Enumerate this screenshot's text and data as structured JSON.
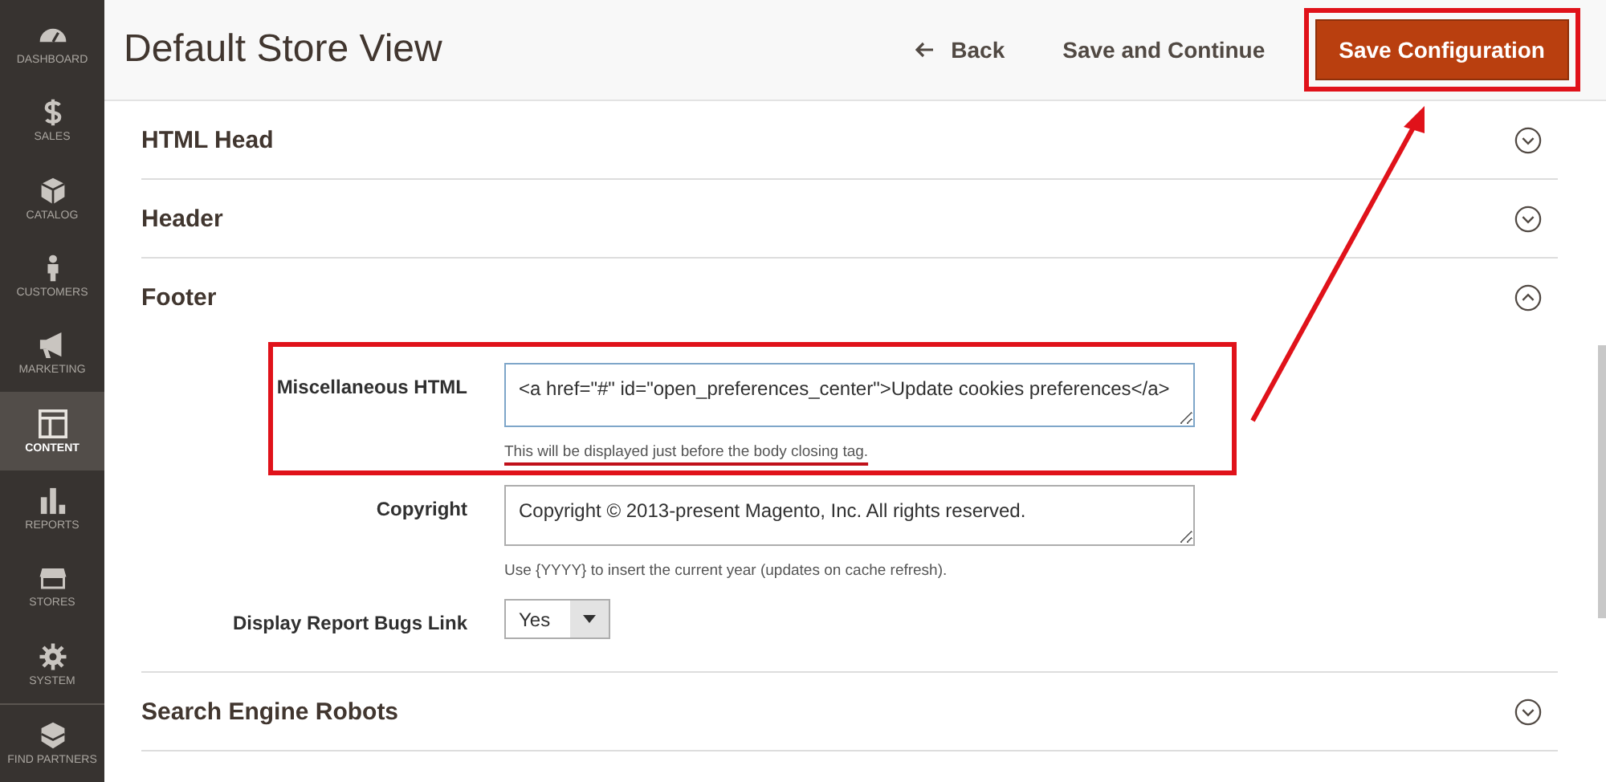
{
  "sidebar": {
    "items": [
      {
        "label": "DASHBOARD",
        "selected": false
      },
      {
        "label": "SALES",
        "selected": false
      },
      {
        "label": "CATALOG",
        "selected": false
      },
      {
        "label": "CUSTOMERS",
        "selected": false
      },
      {
        "label": "MARKETING",
        "selected": false
      },
      {
        "label": "CONTENT",
        "selected": true
      },
      {
        "label": "REPORTS",
        "selected": false
      },
      {
        "label": "STORES",
        "selected": false
      },
      {
        "label": "SYSTEM",
        "selected": false
      },
      {
        "label": "FIND PARTNERS",
        "selected": false
      }
    ]
  },
  "header": {
    "title": "Default Store View",
    "buttons": [
      {
        "label": "Back",
        "kind": "back",
        "highlighted": false
      },
      {
        "label": "Save and Continue",
        "kind": "plain",
        "highlighted": false
      },
      {
        "label": "Save Configuration",
        "kind": "primary",
        "highlighted": true
      }
    ]
  },
  "sections": [
    {
      "title": "HTML Head",
      "expanded": false
    },
    {
      "title": "Header",
      "expanded": false
    },
    {
      "title": "Footer",
      "expanded": true,
      "fields": [
        {
          "kind": "textarea",
          "label": "Miscellaneous HTML",
          "value": "<a href=\"#\" id=\"open_preferences_center\">Update cookies preferences</a>",
          "note": "This will be displayed just before the body closing tag.",
          "highlighted": true
        },
        {
          "kind": "textarea",
          "label": "Copyright",
          "value": "Copyright © 2013-present Magento, Inc. All rights reserved.",
          "note": "Use {YYYY} to insert the current year (updates on cache refresh).",
          "highlighted": false
        },
        {
          "kind": "select",
          "label": "Display Report Bugs Link",
          "value": "Yes",
          "highlighted": false
        }
      ]
    },
    {
      "title": "Search Engine Robots",
      "expanded": false
    }
  ]
}
